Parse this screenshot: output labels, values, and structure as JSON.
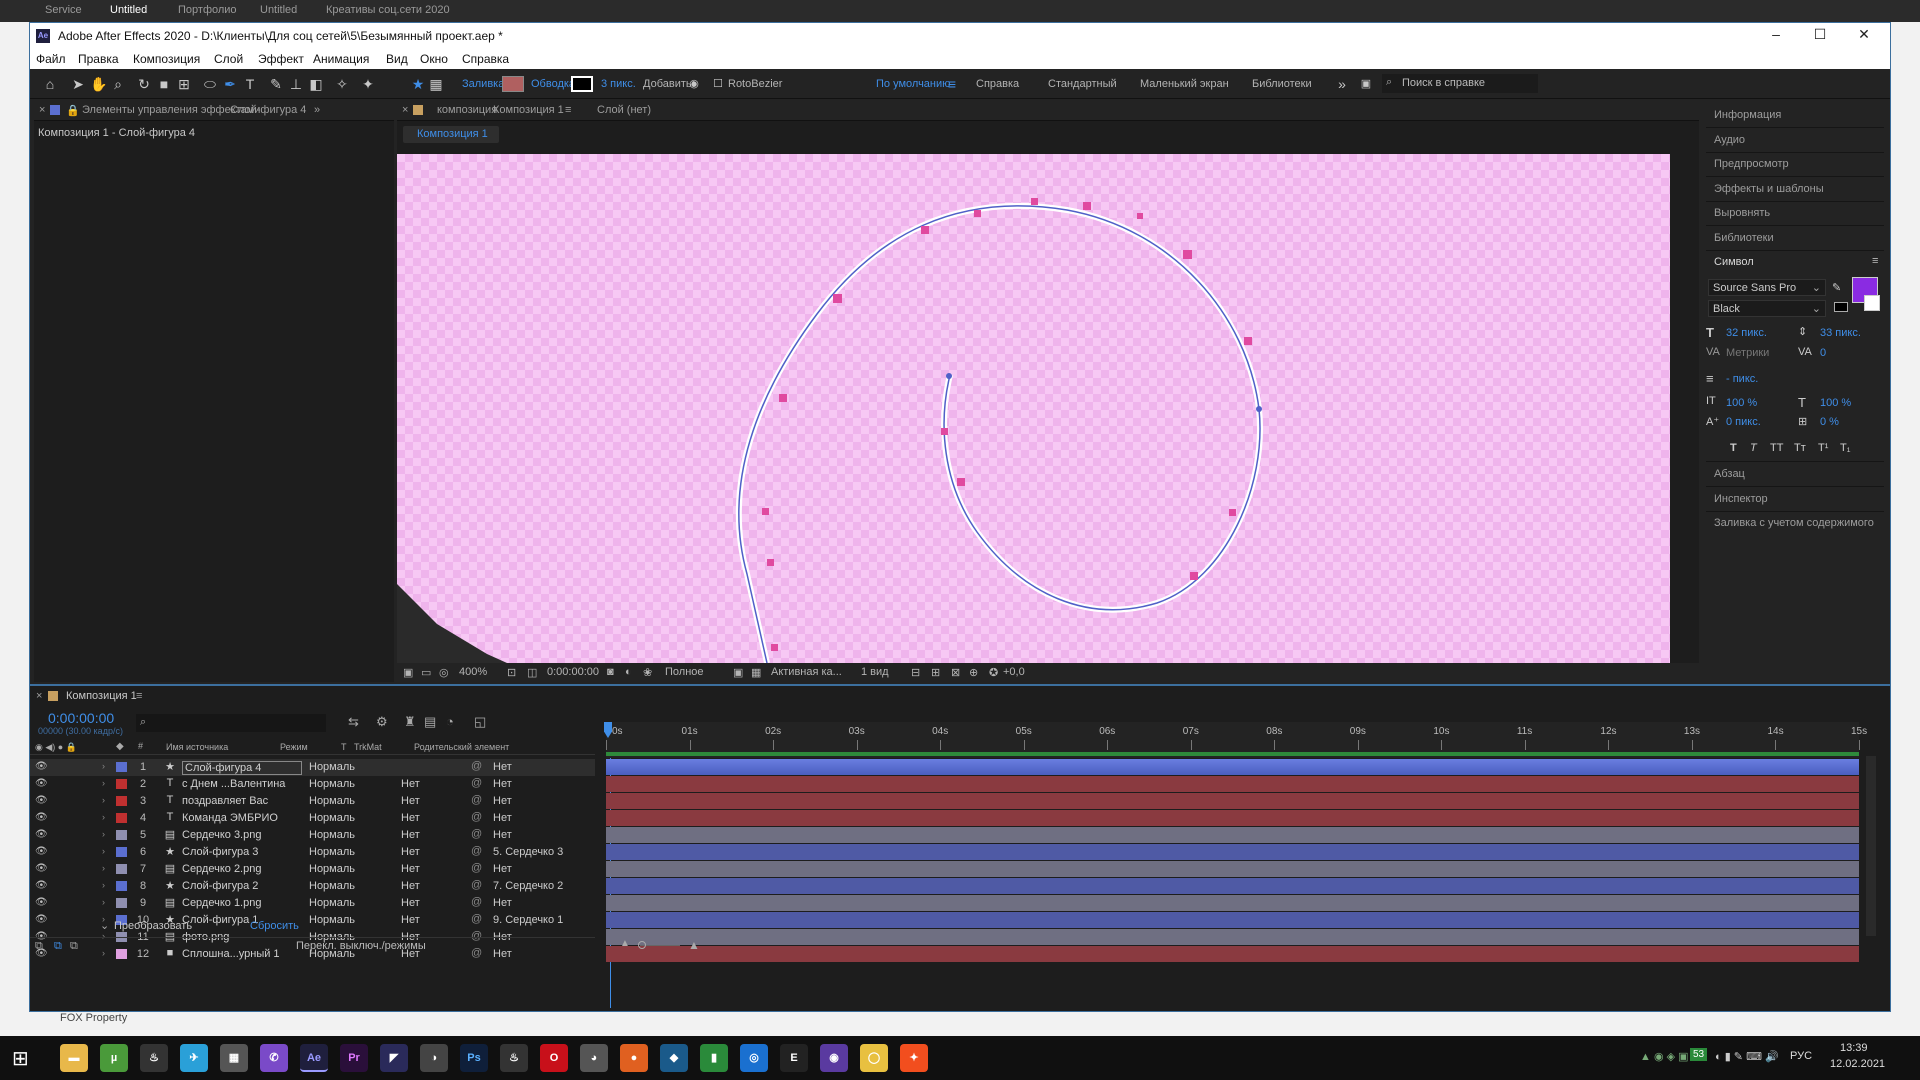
{
  "bg_tabs": [
    "Service",
    "Untitled",
    "Портфолио",
    "Untitled",
    "Креативы соц.сети 2020"
  ],
  "bg_side_text": "FOX Property",
  "app": {
    "title": "Adobe After Effects 2020 - D:\\Клиенты\\Для соц сетей\\5\\Безымянный проект.aep *",
    "logo": "Ae"
  },
  "menu": [
    "Файл",
    "Правка",
    "Композиция",
    "Слой",
    "Эффект",
    "Анимация",
    "Вид",
    "Окно",
    "Справка"
  ],
  "toolbar": {
    "fill_label": "Заливка:",
    "stroke_label": "Обводка:",
    "stroke_size": "3 пикс.",
    "add_label": "Добавить:",
    "rotobezier": "RotoBezier",
    "workspaces": [
      "По умолчанию",
      "Справка",
      "Стандартный",
      "Маленький экран",
      "Библиотеки"
    ],
    "search_placeholder": "Поиск в справке"
  },
  "effects_panel": {
    "title": "Элементы управления эффектами",
    "layer_link": "Слой-фигура 4",
    "breadcrumb": "Композиция 1 - Слой-фигура 4"
  },
  "comp_panel": {
    "prefix": "композиция",
    "name": "Композиция 1",
    "layer_tab": "Слой (нет)",
    "sub_tab": "Композиция 1"
  },
  "comp_footer": {
    "zoom": "400%",
    "timecode": "0:00:00:00",
    "resolution": "Полное",
    "camera": "Активная ка...",
    "views": "1 вид",
    "exposure": "+0,0"
  },
  "right_panel": {
    "items": [
      "Информация",
      "Аудио",
      "Предпросмотр",
      "Эффекты и шаблоны",
      "Выровнять",
      "Библиотеки",
      "Символ"
    ],
    "font": "Source Sans Pro",
    "style": "Black",
    "size": "32 пикс.",
    "leading": "33 пикс.",
    "kerning": "Метрики",
    "tracking": "0",
    "stroke_w": "- пикс.",
    "vscale": "100 %",
    "hscale": "100 %",
    "baseline": "0 пикс.",
    "tsume": "0 %",
    "fmt": [
      "T",
      "T",
      "TT",
      "Tт",
      "T¹",
      "T₁"
    ],
    "bottom_items": [
      "Абзац",
      "Инспектор",
      "Заливка с учетом содержимого"
    ],
    "fill_color": "#8a2be2"
  },
  "timeline": {
    "tab": "Композиция 1",
    "timecode": "0:00:00:00",
    "fps": "00000 (30.00 кадр/с)",
    "cols": [
      "Имя источника",
      "Режим",
      "T",
      "TrkMat",
      "Родительский элемент"
    ],
    "ruler": [
      "0s",
      "01s",
      "02s",
      "03s",
      "04s",
      "05s",
      "06s",
      "07s",
      "08s",
      "09s",
      "10s",
      "11s",
      "12s",
      "13s",
      "14s",
      "15s"
    ],
    "layers": [
      {
        "n": "1",
        "type": "★",
        "name": "Слой-фигура 4",
        "mode": "Нормаль",
        "trk": "",
        "parent": "Нет",
        "color": "#5b6fd0",
        "bar": "#4a5ec0"
      },
      {
        "n": "2",
        "type": "T",
        "name": "с Днем ...Валентина",
        "mode": "Нормаль",
        "trk": "Нет",
        "parent": "Нет",
        "color": "#c03030",
        "bar": "#8a3a40"
      },
      {
        "n": "3",
        "type": "T",
        "name": "поздравляет Вас",
        "mode": "Нормаль",
        "trk": "Нет",
        "parent": "Нет",
        "color": "#c03030",
        "bar": "#8a3a40"
      },
      {
        "n": "4",
        "type": "T",
        "name": "Команда ЭМБРИО",
        "mode": "Нормаль",
        "trk": "Нет",
        "parent": "Нет",
        "color": "#c03030",
        "bar": "#8a3a40"
      },
      {
        "n": "5",
        "type": "▤",
        "name": "Сердечко 3.png",
        "mode": "Нормаль",
        "trk": "Нет",
        "parent": "Нет",
        "color": "#8f8fb0",
        "bar": "#6f6f82"
      },
      {
        "n": "6",
        "type": "★",
        "name": "Слой-фигура 3",
        "mode": "Нормаль",
        "trk": "Нет",
        "parent": "5. Сердечко 3",
        "color": "#5b6fd0",
        "bar": "#4f5aa5"
      },
      {
        "n": "7",
        "type": "▤",
        "name": "Сердечко 2.png",
        "mode": "Нормаль",
        "trk": "Нет",
        "parent": "Нет",
        "color": "#8f8fb0",
        "bar": "#6f6f82"
      },
      {
        "n": "8",
        "type": "★",
        "name": "Слой-фигура 2",
        "mode": "Нормаль",
        "trk": "Нет",
        "parent": "7. Сердечко 2",
        "color": "#5b6fd0",
        "bar": "#4f5aa5"
      },
      {
        "n": "9",
        "type": "▤",
        "name": "Сердечко 1.png",
        "mode": "Нормаль",
        "trk": "Нет",
        "parent": "Нет",
        "color": "#8f8fb0",
        "bar": "#6f6f82"
      },
      {
        "n": "10",
        "type": "★",
        "name": "Слой-фигура 1",
        "mode": "Нормаль",
        "trk": "Нет",
        "parent": "9. Сердечко 1",
        "color": "#5b6fd0",
        "bar": "#4f5aa5"
      },
      {
        "n": "11",
        "type": "▤",
        "name": "фото.png",
        "mode": "Нормаль",
        "trk": "Нет",
        "parent": "Нет",
        "color": "#8f8fb0",
        "bar": "#6f6f82"
      },
      {
        "n": "12",
        "type": "■",
        "name": "Сплошна...урный 1",
        "mode": "Нормаль",
        "trk": "Нет",
        "parent": "Нет",
        "color": "#e0a0e0",
        "bar": "#8a3a40"
      }
    ],
    "transform_label": "Преобразовать",
    "reset_label": "Сбросить",
    "switches_label": "Перекл. выключ./режимы"
  },
  "taskbar": {
    "apps": [
      "Ps",
      "Ae",
      "Pr"
    ],
    "lang": "РУС",
    "time": "13:39",
    "date": "12.02.2021",
    "badge": "53"
  }
}
